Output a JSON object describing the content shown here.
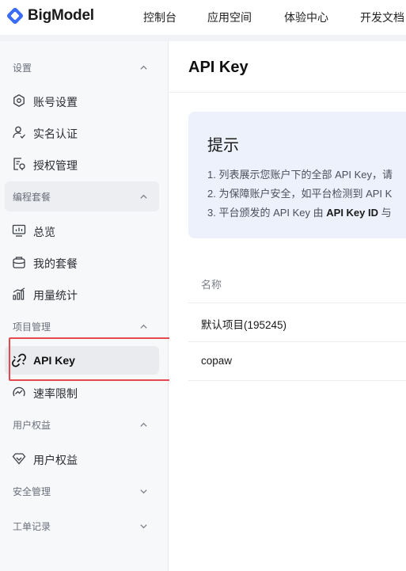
{
  "app": {
    "brand": "BigModel",
    "top_nav": [
      "控制台",
      "应用空间",
      "体验中心",
      "开发文档"
    ]
  },
  "sidebar": {
    "sections": [
      {
        "title": "设置",
        "expanded": true,
        "items": [
          {
            "label": "账号设置",
            "icon": "gear-icon"
          },
          {
            "label": "实名认证",
            "icon": "user-check-icon"
          },
          {
            "label": "授权管理",
            "icon": "document-check-icon"
          }
        ]
      },
      {
        "title": "编程套餐",
        "expanded": true,
        "items": [
          {
            "label": "总览",
            "icon": "monitor-chart-icon"
          },
          {
            "label": "我的套餐",
            "icon": "package-icon"
          },
          {
            "label": "用量统计",
            "icon": "bar-chart-icon"
          }
        ]
      },
      {
        "title": "项目管理",
        "expanded": true,
        "items": [
          {
            "label": "API Key",
            "icon": "key-link-icon",
            "active": true
          },
          {
            "label": "速率限制",
            "icon": "gauge-icon"
          }
        ]
      },
      {
        "title": "用户权益",
        "expanded": true,
        "items": [
          {
            "label": "用户权益",
            "icon": "diamond-icon"
          }
        ]
      },
      {
        "title": "安全管理",
        "expanded": false,
        "items": []
      },
      {
        "title": "工单记录",
        "expanded": false,
        "items": []
      }
    ]
  },
  "main": {
    "title": "API Key",
    "tip": {
      "title": "提示",
      "line1": "1. 列表展示您账户下的全部 API Key，请",
      "line2": "2. 为保障账户安全，如平台检测到 API K",
      "line3_prefix": "3. 平台颁发的 API Key 由 ",
      "line3_bold": "API Key ID",
      "line3_suffix": " 与"
    },
    "table": {
      "column_name": "名称",
      "rows": [
        "默认项目(195245)",
        "copaw"
      ]
    }
  },
  "colors": {
    "highlight": "#e5484d",
    "tip_background": "#edf1fb",
    "sidebar_background": "#f7f8fa"
  }
}
